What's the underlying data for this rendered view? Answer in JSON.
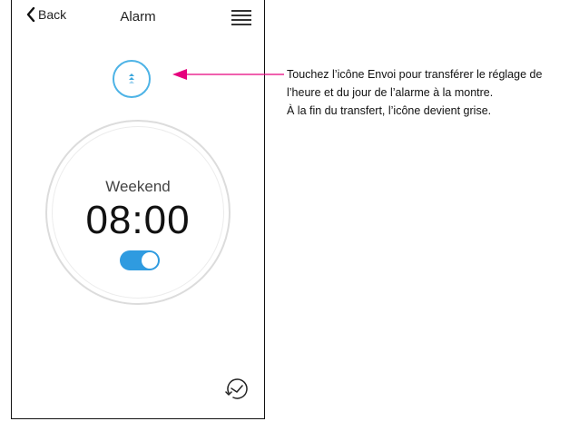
{
  "header": {
    "back_label": "Back",
    "title": "Alarm"
  },
  "alarm": {
    "label": "Weekend",
    "time": "08:00",
    "enabled": true
  },
  "annotation": {
    "lines": [
      "Touchez l’icône Envoi pour transférer le réglage de",
      "l’heure et du jour de l’alarme à la montre.",
      "À la fin du transfert, l’icône devient grise."
    ]
  },
  "colors": {
    "accent": "#2f9be0",
    "send_ring": "#4db3e6",
    "arrow": "#e6007e"
  },
  "icons": {
    "back": "chevron-left-icon",
    "menu": "hamburger-menu-icon",
    "send": "send-arrows-icon",
    "clock": "clock-history-icon"
  }
}
